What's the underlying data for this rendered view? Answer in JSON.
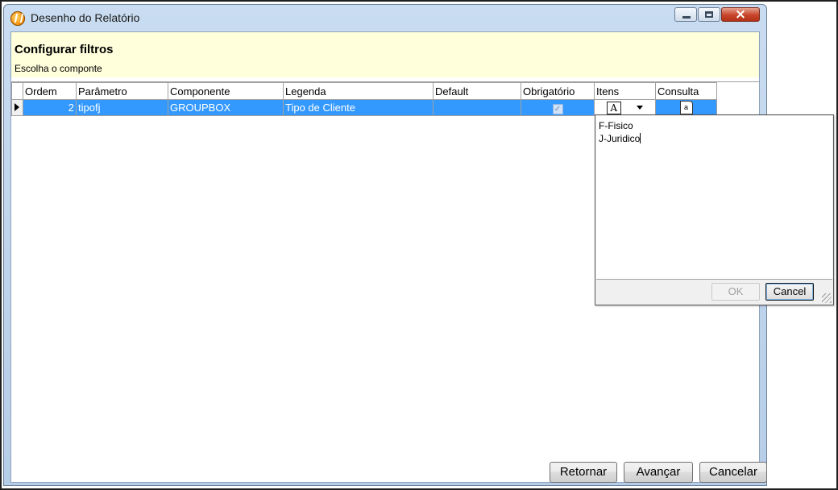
{
  "window": {
    "title": "Desenho do Relatório"
  },
  "header": {
    "title": "Configurar filtros",
    "subtitle": "Escolha o componte"
  },
  "grid": {
    "columns": [
      "Ordem",
      "Parâmetro",
      "Componente",
      "Legenda",
      "Default",
      "Obrigatório",
      "Itens",
      "Consulta"
    ],
    "rows": [
      {
        "ordem": "2",
        "parametro": "tipofj",
        "componente": "GROUPBOX",
        "legenda": "Tipo de Cliente",
        "default": "",
        "obrigatorio_checked": true,
        "itens_icon": "A",
        "consulta_icon": "a"
      }
    ]
  },
  "items_editor": {
    "lines": [
      "F-Fisico",
      "J-Juridico"
    ],
    "ok_label": "OK",
    "cancel_label": "Cancel"
  },
  "buttons": {
    "retornar": "Retornar",
    "avancar": "Avançar",
    "cancelar": "Cancelar"
  },
  "icons": {
    "app": "app-logo-icon",
    "minimize": "minimize-icon",
    "maximize": "maximize-icon",
    "close": "close-icon",
    "row_indicator": "row-pointer-icon",
    "itens_editor": "text-editor-icon",
    "dropdown": "chevron-down-icon",
    "consulta": "document-icon",
    "resize": "resize-grip-icon"
  },
  "colors": {
    "selection": "#3399ff",
    "header_band": "#ffffdc",
    "title_bar": "#c9dcf1",
    "close_button": "#c7442a"
  }
}
